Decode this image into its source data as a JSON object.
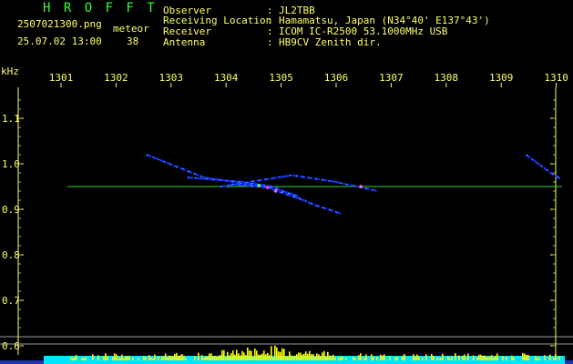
{
  "app": {
    "title": "H R O F F T",
    "title_color": "#33ff33"
  },
  "file": {
    "name": "2507021300.png",
    "datetime": "25.07.02 13:00"
  },
  "meteor": {
    "label": "meteor",
    "count": "38"
  },
  "info": [
    {
      "key": "Observer",
      "sep": ":",
      "value": "JL2TBB"
    },
    {
      "key": "Receiving Location",
      "sep": ":",
      "value": "Hamamatsu, Japan (N34°40' E137°43')"
    },
    {
      "key": "Receiver",
      "sep": ":",
      "value": "ICOM IC-R2500 53.1000MHz USB"
    },
    {
      "key": "Antenna",
      "sep": ":",
      "value": "HB9CV Zenith dir."
    }
  ],
  "chart_data": {
    "type": "spectrogram",
    "x_unit": "time (HHMM)",
    "xlabel": "",
    "x_ticks": [
      "1301",
      "1302",
      "1303",
      "1304",
      "1305",
      "1306",
      "1307",
      "1308",
      "1309",
      "1310"
    ],
    "y_unit_label": "kHz",
    "y_ticks": [
      "1.1",
      "1.0",
      "0.9",
      "0.8",
      "0.7",
      "0.6"
    ],
    "ylim": [
      0.6,
      1.1
    ],
    "carrier_khz": 0.95,
    "carrier_color": "#33dd33",
    "echo_traces": [
      {
        "x": [
          1302.55,
          1303.6,
          1304.7,
          1305.4
        ],
        "y": [
          1.02,
          0.97,
          0.95,
          0.92
        ]
      },
      {
        "x": [
          1303.3,
          1304.3,
          1304.85,
          1305.6,
          1306.1
        ],
        "y": [
          0.97,
          0.96,
          0.95,
          0.91,
          0.89
        ]
      },
      {
        "x": [
          1303.9,
          1305.2,
          1306.0,
          1306.75
        ],
        "y": [
          0.95,
          0.975,
          0.96,
          0.94
        ]
      },
      {
        "x": [
          1304.1,
          1304.8,
          1305.3
        ],
        "y": [
          0.955,
          0.948,
          0.93
        ]
      },
      {
        "x": [
          1309.45,
          1309.9,
          1310.1
        ],
        "y": [
          1.02,
          0.98,
          0.965
        ]
      }
    ],
    "noise_band_color": "#00e5ff",
    "noise_peak_color": "#ffff00"
  }
}
